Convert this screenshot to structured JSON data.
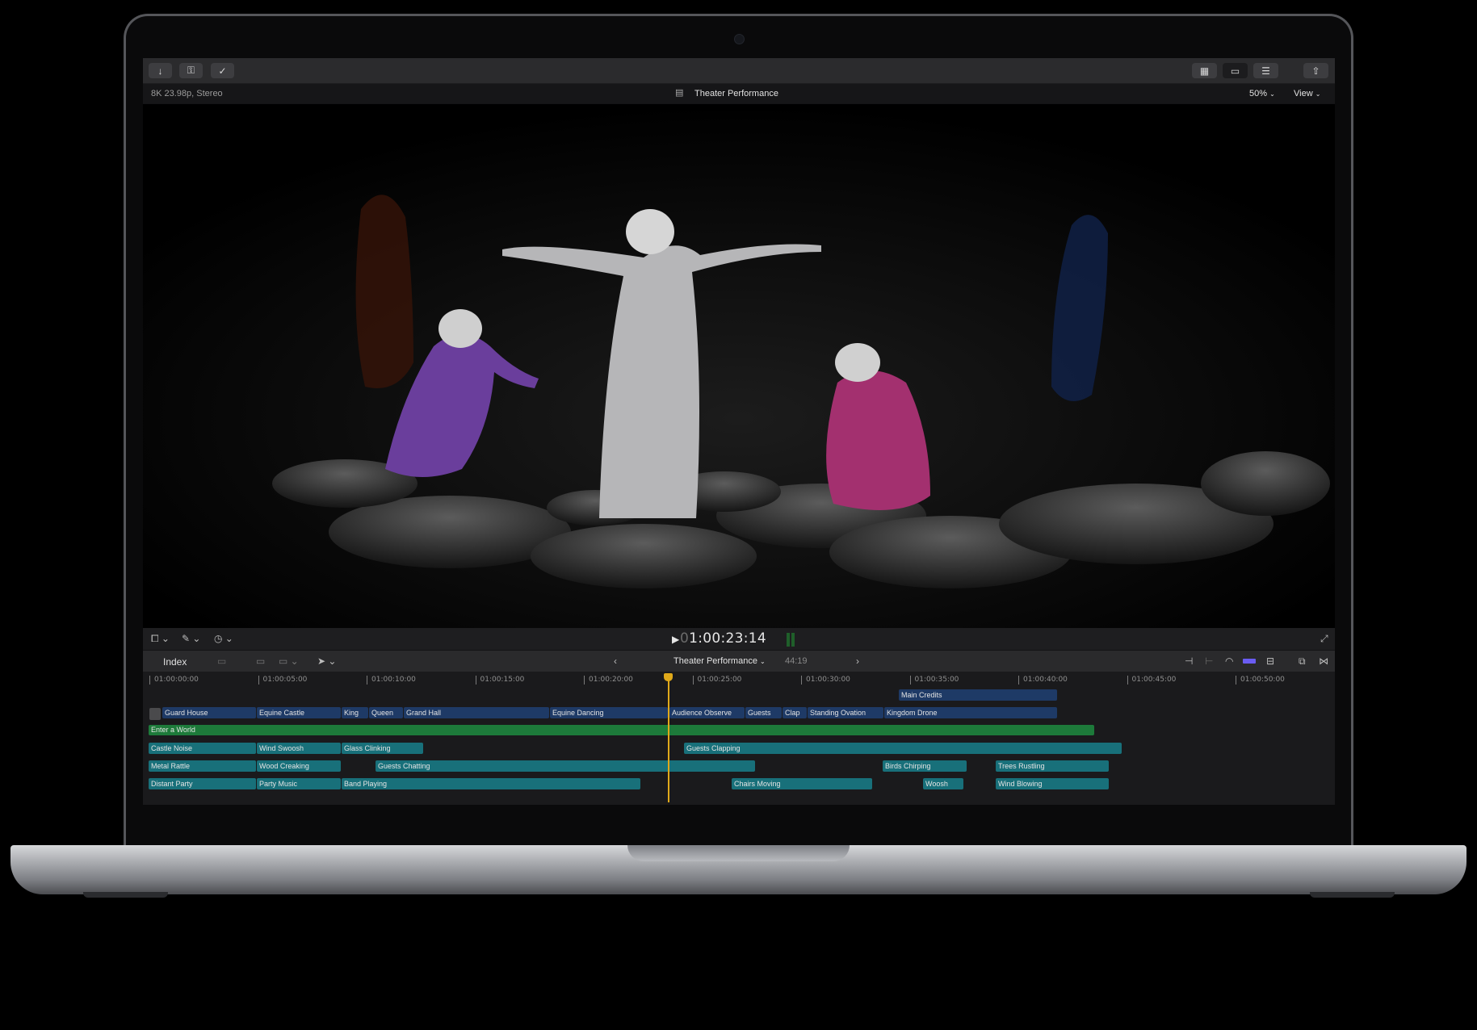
{
  "toolbar": {
    "left_buttons": [
      {
        "name": "import-button",
        "icon": "download-arrow-icon",
        "glyph": "↓"
      },
      {
        "name": "keywords-button",
        "icon": "key-icon",
        "glyph": "⚿"
      },
      {
        "name": "background-tasks-button",
        "icon": "checkmark-circle-icon",
        "glyph": "✓"
      }
    ],
    "right_buttons": [
      {
        "name": "browser-toggle",
        "icon": "grid-icon",
        "glyph": "▦"
      },
      {
        "name": "timeline-toggle",
        "icon": "timeline-icon",
        "glyph": "▭"
      },
      {
        "name": "inspector-toggle",
        "icon": "sliders-icon",
        "glyph": "☰"
      },
      {
        "name": "share-button",
        "icon": "share-icon",
        "glyph": "⇧"
      }
    ]
  },
  "infobar": {
    "format": "8K 23.98p, Stereo",
    "project_title": "Theater Performance",
    "zoom": "50%",
    "view_menu": "View"
  },
  "viewer_controls": {
    "timecode_dim": "0",
    "timecode": "1:00:23:14"
  },
  "timeline_header": {
    "index_label": "Index",
    "project_title": "Theater Performance",
    "duration": "44:19"
  },
  "ruler": [
    "01:00:00:00",
    "01:00:05:00",
    "01:00:10:00",
    "01:00:15:00",
    "01:00:20:00",
    "01:00:25:00",
    "01:00:30:00",
    "01:00:35:00",
    "01:00:40:00",
    "01:00:45:00",
    "01:00:50:00"
  ],
  "clips": {
    "titles": [
      "Main Credits"
    ],
    "primary": [
      "Guard House",
      "Equine Castle",
      "King",
      "Queen",
      "Grand Hall",
      "Equine Dancing",
      "Audience Observe",
      "Guests",
      "Clap",
      "Standing Ovation",
      "Kingdom Drone"
    ],
    "music": [
      "Enter a World"
    ],
    "audio1": [
      "Castle Noise",
      "Wind Swoosh",
      "Glass Clinking",
      "Guests Clapping"
    ],
    "audio2": [
      "Metal Rattle",
      "Wood Creaking",
      "Guests Chatting",
      "Birds Chirping",
      "Trees Rustling"
    ],
    "audio3": [
      "Distant Party",
      "Party Music",
      "Band Playing",
      "Chairs Moving",
      "Woosh",
      "Wind Blowing"
    ]
  },
  "colors": {
    "playhead": "#e0a91a",
    "video_clip": "#1e3a66",
    "music_clip": "#1d7a3a",
    "audio_clip": "#18707a"
  }
}
